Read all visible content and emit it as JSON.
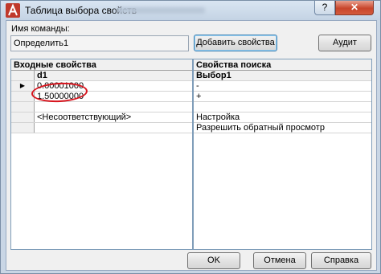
{
  "window": {
    "title": "Таблица выбора свойств",
    "help_glyph": "?",
    "close_glyph": "✕"
  },
  "command": {
    "label": "Имя команды:",
    "value": "Определить1",
    "add_button": "Добавить свойства ...",
    "audit_button": "Аудит"
  },
  "input_properties": {
    "title": "Входные свойства",
    "column": "d1",
    "rows": [
      {
        "marker": "▶",
        "value": "0.00001000"
      },
      {
        "marker": "",
        "value": "1.50000000"
      },
      {
        "marker": "",
        "value": ""
      },
      {
        "marker": "",
        "value": "<Несоответствующий>"
      },
      {
        "marker": "",
        "value": ""
      }
    ]
  },
  "lookup_properties": {
    "title": "Свойства поиска",
    "column": "Выбор1",
    "rows": [
      "-",
      "+",
      "",
      "Настройка",
      "Разрешить обратный просмотр"
    ]
  },
  "footer": {
    "ok": "OK",
    "cancel": "Отмена",
    "help": "Справка"
  },
  "colors": {
    "accent_red": "#d8141d",
    "title_gradient_top": "#d9e5f2",
    "close_red": "#c8452b"
  }
}
